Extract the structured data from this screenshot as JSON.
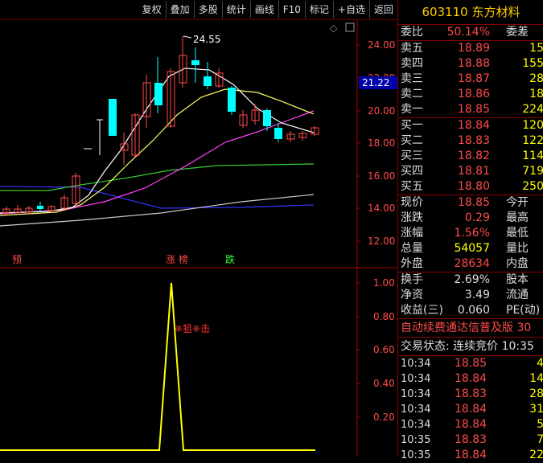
{
  "toolbar": {
    "buttons": [
      "复权",
      "叠加",
      "多股",
      "统计",
      "画线",
      "F10",
      "标记",
      "+自选",
      "返回"
    ]
  },
  "main_chart": {
    "high_label": "24.55",
    "current_price_tag": "21.22",
    "price_axis_ticks": [
      "24.00",
      "22.00",
      "20.00",
      "18.00",
      "16.00",
      "14.00",
      "12.00"
    ],
    "event_labels": [
      {
        "text": "预",
        "color": "#ff4a4a"
      },
      {
        "text": "涨 榜",
        "color": "#ff4a4a"
      },
      {
        "text": "跌",
        "color": "#33ff33"
      }
    ],
    "diamond_icon": "diamond-icon",
    "square_icon": "square-icon"
  },
  "indicator": {
    "axis_ticks": [
      "1.00",
      "0.80",
      "0.60",
      "0.40",
      "0.20"
    ],
    "signal_text": "※狙※击",
    "signal_color": "#ff3333",
    "line_color": "#ffff00"
  },
  "colors": {
    "up_candle": "#ff4a4a",
    "down_candle": "#00ffff",
    "ma_white": "#ffffff",
    "ma_yellow": "#ffff66",
    "ma_magenta": "#ff44ff",
    "ma_green": "#33cc33",
    "ma_gray": "#cccccc",
    "ma_blue": "#3333ff"
  },
  "stock": {
    "code": "603110",
    "name": "东方材料"
  },
  "order_book": {
    "ratio_label": "委比",
    "ratio_value": "50.14%",
    "diff_label": "委差",
    "sells": [
      {
        "label": "卖五",
        "price": "18.89",
        "vol": "15"
      },
      {
        "label": "卖四",
        "price": "18.88",
        "vol": "155"
      },
      {
        "label": "卖三",
        "price": "18.87",
        "vol": "28"
      },
      {
        "label": "卖二",
        "price": "18.86",
        "vol": "18"
      },
      {
        "label": "卖一",
        "price": "18.85",
        "vol": "224"
      }
    ],
    "buys": [
      {
        "label": "买一",
        "price": "18.84",
        "vol": "120"
      },
      {
        "label": "买二",
        "price": "18.83",
        "vol": "122"
      },
      {
        "label": "买三",
        "price": "18.82",
        "vol": "114"
      },
      {
        "label": "买四",
        "price": "18.81",
        "vol": "719"
      },
      {
        "label": "买五",
        "price": "18.80",
        "vol": "250"
      }
    ]
  },
  "quote": {
    "rows": [
      {
        "l1": "现价",
        "v1": "18.85",
        "l2": "今开",
        "color": "#ff4a4a"
      },
      {
        "l1": "涨跌",
        "v1": "0.29",
        "l2": "最高",
        "color": "#ff4a4a"
      },
      {
        "l1": "涨幅",
        "v1": "1.56%",
        "l2": "最低",
        "color": "#ff4a4a"
      },
      {
        "l1": "总量",
        "v1": "54057",
        "l2": "量比",
        "color": "#ffff00"
      },
      {
        "l1": "外盘",
        "v1": "28634",
        "l2": "内盘",
        "color": "#ff4a4a"
      }
    ]
  },
  "finance": {
    "rows": [
      {
        "l1": "换手",
        "v1": "2.69%",
        "l2": "股本"
      },
      {
        "l1": "净资",
        "v1": "3.49",
        "l2": "流通"
      },
      {
        "l1": "收益(三)",
        "v1": "0.060",
        "l2": "PE(动)"
      }
    ]
  },
  "ticker_text": "自动续费通达信普及版 30",
  "trade_state": "交易状态: 连续竞价 10:35",
  "ticks": [
    {
      "time": "10:34",
      "price": "18.85",
      "vol": "4",
      "color": "#ff4a4a"
    },
    {
      "time": "10:34",
      "price": "18.84",
      "vol": "14",
      "color": "#ff4a4a"
    },
    {
      "time": "10:34",
      "price": "18.83",
      "vol": "28",
      "color": "#ff4a4a"
    },
    {
      "time": "10:34",
      "price": "18.84",
      "vol": "31",
      "color": "#ff4a4a"
    },
    {
      "time": "10:34",
      "price": "18.84",
      "vol": "5",
      "color": "#ff4a4a"
    },
    {
      "time": "10:35",
      "price": "18.83",
      "vol": "7",
      "color": "#ff4a4a"
    },
    {
      "time": "10:35",
      "price": "18.84",
      "vol": "22",
      "color": "#ff4a4a"
    }
  ]
}
